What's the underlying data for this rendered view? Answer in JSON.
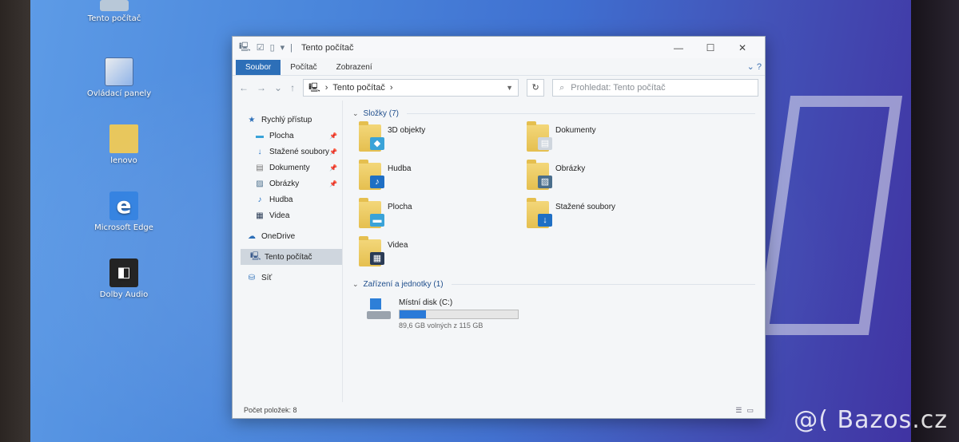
{
  "desktop": {
    "icons": [
      {
        "label": "Tento počítač"
      },
      {
        "label": "Ovládací panely"
      },
      {
        "label": "lenovo"
      },
      {
        "label": "Microsoft Edge"
      },
      {
        "label": "Dolby Audio"
      }
    ]
  },
  "watermark": "@( Bazos.cz",
  "window": {
    "title": "Tento počítač",
    "ribbon_tabs": [
      {
        "label": "Soubor",
        "active": true
      },
      {
        "label": "Počítač",
        "active": false
      },
      {
        "label": "Zobrazení",
        "active": false
      }
    ],
    "address": {
      "path": "Tento počítač",
      "search_placeholder": "Prohledat: Tento počítač"
    },
    "nav": {
      "quick_access": "Rychlý přístup",
      "quick_items": [
        {
          "label": "Plocha",
          "icon": "desktop-icon",
          "pinned": true
        },
        {
          "label": "Stažené soubory",
          "icon": "download-icon",
          "pinned": true
        },
        {
          "label": "Dokumenty",
          "icon": "documents-icon",
          "pinned": true
        },
        {
          "label": "Obrázky",
          "icon": "pictures-icon",
          "pinned": true
        },
        {
          "label": "Hudba",
          "icon": "music-icon",
          "pinned": false
        },
        {
          "label": "Videa",
          "icon": "videos-icon",
          "pinned": false
        }
      ],
      "onedrive": "OneDrive",
      "this_pc": "Tento počítač",
      "network": "Síť"
    },
    "folders_header": "Složky (7)",
    "folders": [
      {
        "name": "3D objekty",
        "icon": "3d-objects-icon",
        "badge_color": "#3aa3d8"
      },
      {
        "name": "Dokumenty",
        "icon": "documents-icon",
        "badge_color": "#cfd6de"
      },
      {
        "name": "Hudba",
        "icon": "music-icon",
        "badge_color": "#1f6fc4"
      },
      {
        "name": "Obrázky",
        "icon": "pictures-icon",
        "badge_color": "#4a6e8c"
      },
      {
        "name": "Plocha",
        "icon": "desktop-icon",
        "badge_color": "#3aa3d8"
      },
      {
        "name": "Stažené soubory",
        "icon": "download-icon",
        "badge_color": "#1f6fc4"
      },
      {
        "name": "Videa",
        "icon": "videos-icon",
        "badge_color": "#2a3b55"
      }
    ],
    "drives_header": "Zařízení a jednotky (1)",
    "drive": {
      "name": "Místní disk (C:)",
      "free_text": "89,6 GB volných z 115 GB",
      "used_fraction": 0.22
    },
    "status": "Počet položek: 8"
  },
  "colors": {
    "accent": "#2d6fb8",
    "drive_bar": "#2a7ad8"
  }
}
